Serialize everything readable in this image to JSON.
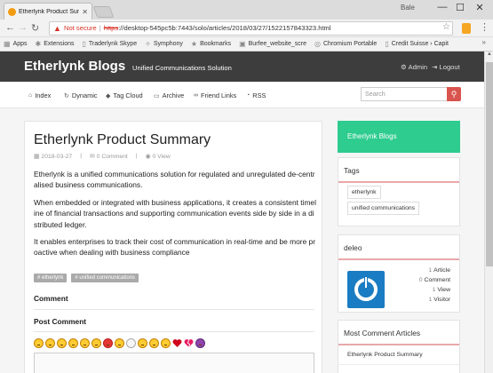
{
  "browser": {
    "tab_title": "Etherlynk Product Summ",
    "user": "Bale",
    "url_warning": "Not secure",
    "url_scheme": "https",
    "url_rest": "://desktop-545pc5b:7443/solo/articles/2018/03/27/1522157843323.html",
    "bookmarks": [
      {
        "label": "Apps",
        "icon": "apps-icon"
      },
      {
        "label": "Extensions",
        "icon": "puzzle-icon"
      },
      {
        "label": "Traderlynk Skype",
        "icon": "page-icon"
      },
      {
        "label": "Symphony",
        "icon": "symphony-icon"
      },
      {
        "label": "Bookmarks",
        "icon": "star-icon"
      },
      {
        "label": "Burfee_website_scre",
        "icon": "video-icon"
      },
      {
        "label": "Chromium Portable",
        "icon": "chrome-icon"
      },
      {
        "label": "Credit Suisse › Capit",
        "icon": "page-icon"
      }
    ]
  },
  "site": {
    "brand": "Etherlynk Blogs",
    "tagline": "Unified Communications Solution",
    "admin_label": "Admin",
    "logout_label": "Logout",
    "nav": [
      "Index",
      "Dynamic",
      "Tag Cloud",
      "Archive",
      "Friend Links",
      "RSS"
    ],
    "search_placeholder": "Search"
  },
  "article": {
    "title": "Etherlynk Product Summary",
    "date": "2018-03-27",
    "comments": "0 Comment",
    "views": "0 View",
    "paragraphs": [
      "Etherlynk is a unified communications solution for regulated and unregulated de-centralised business communications.",
      "When embedded or integrated with business applications, it creates a consistent timeline of financial transactions and supporting communication events side by side in a distributed ledger.",
      "It enables enterprises to track their cost of communication in real-time and be more proactive when dealing with business compliance"
    ],
    "tags": [
      "# etherlynk",
      "# unified communications"
    ],
    "comment_heading": "Comment",
    "post_comment_heading": "Post Comment"
  },
  "sidebar": {
    "blog_title": "Etherlynk Blogs",
    "tags_heading": "Tags",
    "tags": [
      "etherlynk",
      "unified communications"
    ],
    "user_name": "deleo",
    "stats": [
      {
        "n": "1",
        "label": "Article"
      },
      {
        "n": "0",
        "label": "Comment"
      },
      {
        "n": "1",
        "label": "View"
      },
      {
        "n": "1",
        "label": "Visitor"
      }
    ],
    "most_comment_heading": "Most Comment Articles",
    "most_comment_items": [
      "Etherlynk Product Summary"
    ]
  },
  "colors": {
    "header_bg": "#3d3d3d",
    "sidebar_green": "#2ecc8f",
    "search_button": "#d9534f",
    "avatar_blue": "#1a7cc2"
  }
}
